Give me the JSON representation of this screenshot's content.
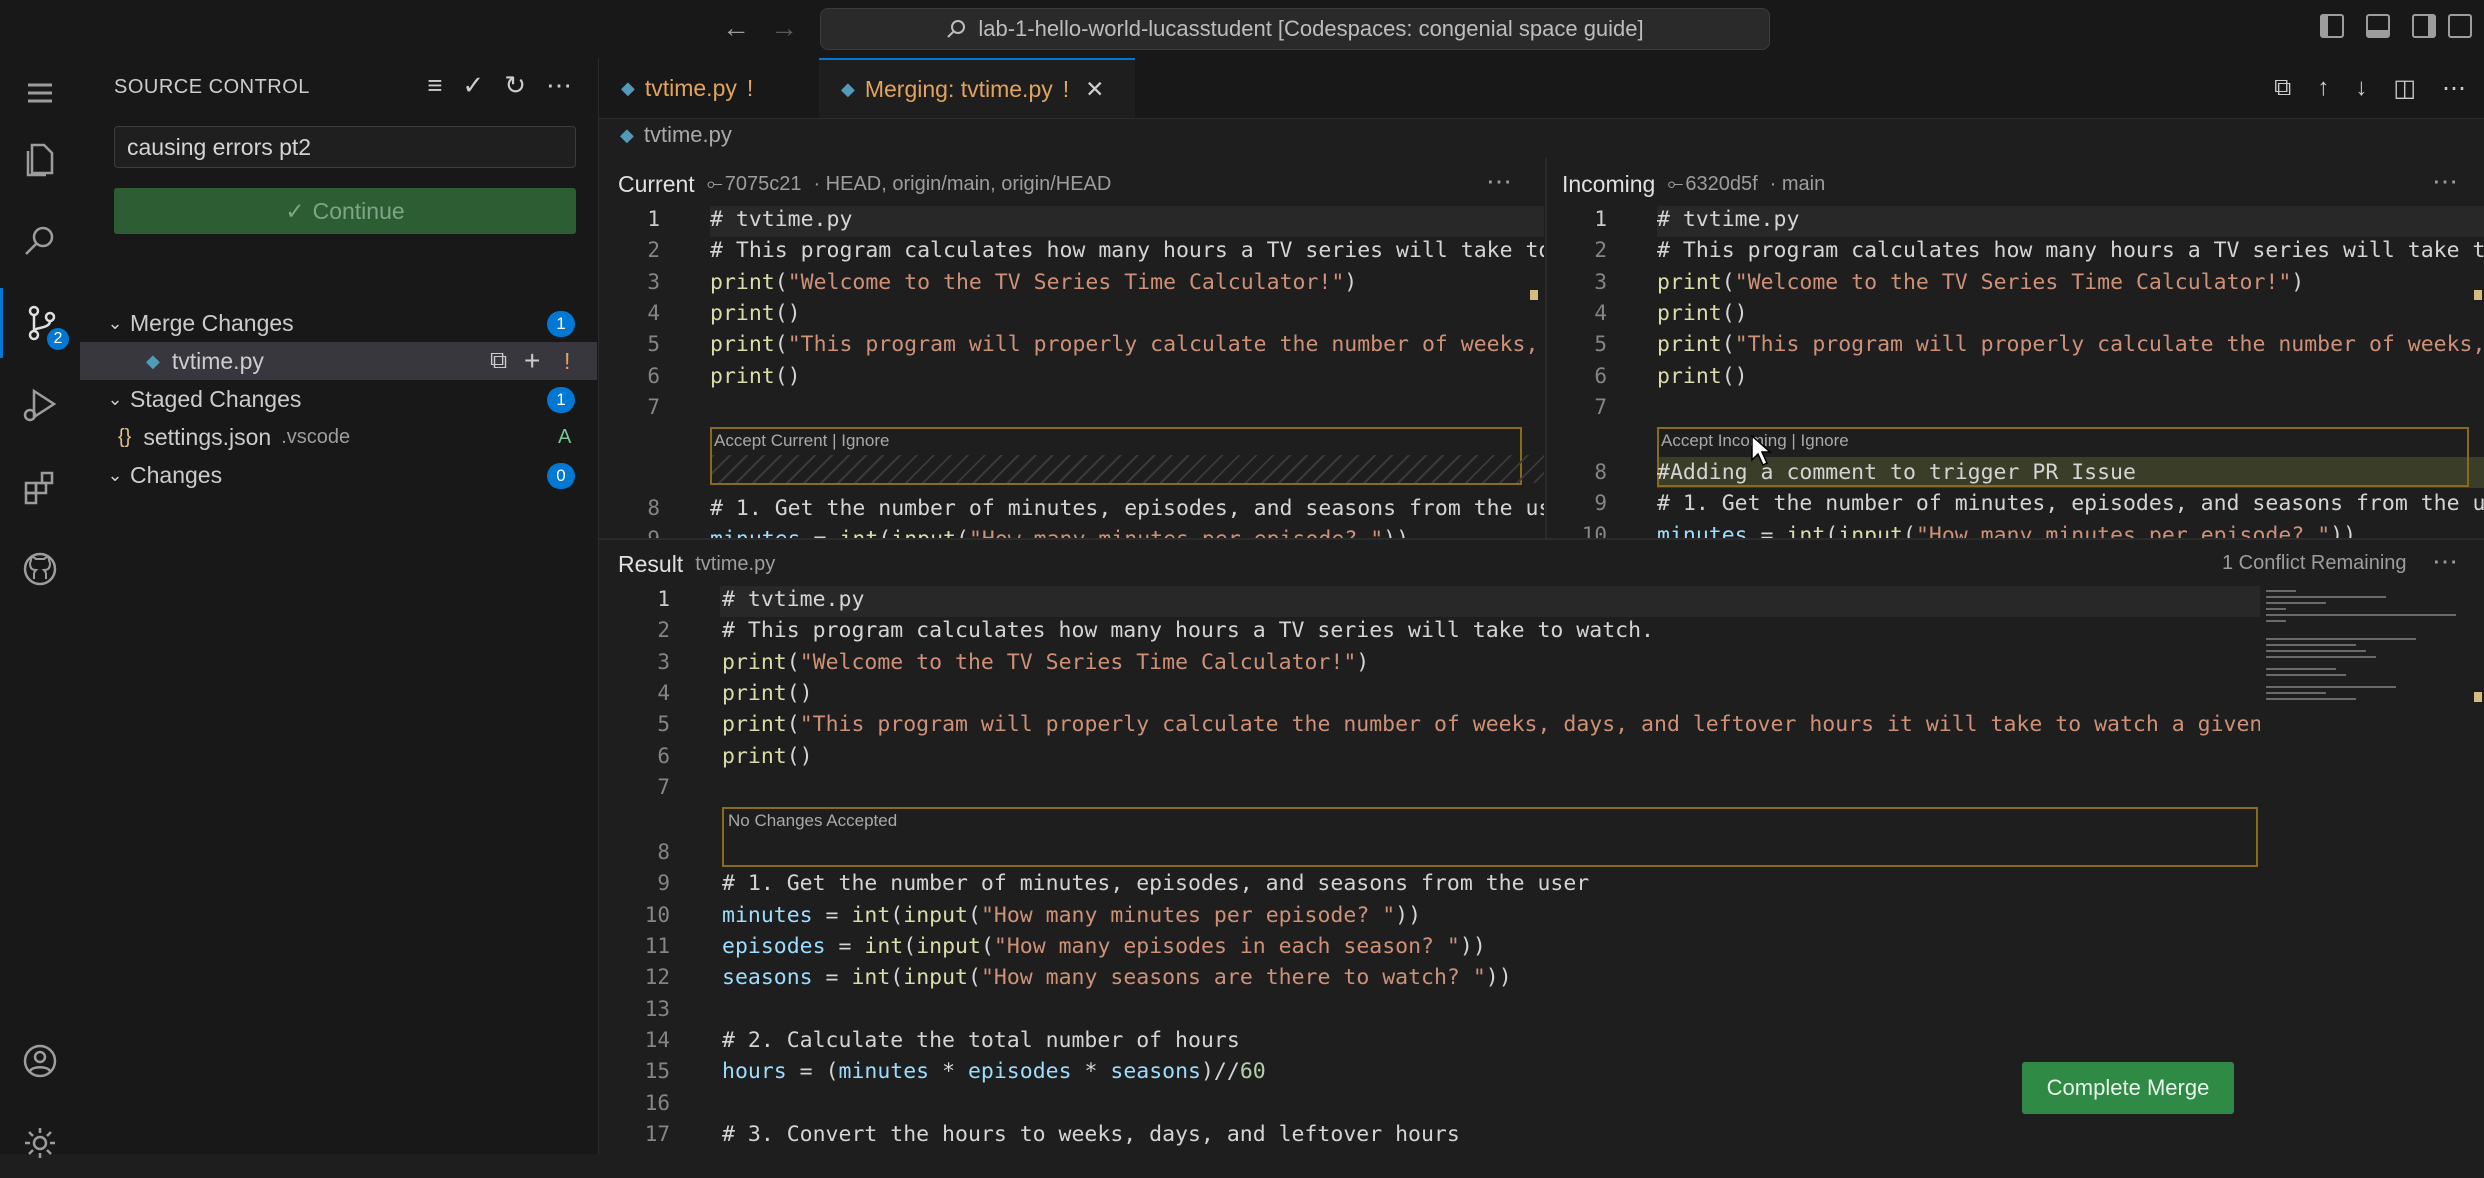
{
  "titlebar": {
    "back": "←",
    "forward": "→",
    "command_center": "lab-1-hello-world-lucasstudent [Codespaces: congenial space guide]"
  },
  "activity": {
    "scm_badge": "2"
  },
  "sidebar": {
    "title": "SOURCE CONTROL",
    "commit_message": "causing errors pt2",
    "continue_label": "Continue",
    "groups": [
      {
        "label": "Merge Changes",
        "count": "1"
      },
      {
        "label": "Staged Changes",
        "count": "1"
      },
      {
        "label": "Changes",
        "count": "0"
      }
    ],
    "merge_file": {
      "name": "tvtime.py",
      "status": "!"
    },
    "staged_file": {
      "name": "settings.json",
      "dir": ".vscode",
      "status": "A"
    }
  },
  "tabs": [
    {
      "label": "tvtime.py",
      "status": "!"
    },
    {
      "label": "Merging: tvtime.py",
      "status": "!"
    }
  ],
  "breadcrumb": "tvtime.py",
  "current": {
    "title": "Current",
    "commit": "7075c21",
    "refs": "· HEAD, origin/main, origin/HEAD",
    "codelens": "Accept Current | Ignore"
  },
  "incoming": {
    "title": "Incoming",
    "commit": "6320d5f",
    "refs": "· main",
    "codelens": "Accept Incoming | Ignore"
  },
  "result": {
    "title": "Result",
    "file": "tvtime.py",
    "conflicts": "1 Conflict Remaining",
    "codelens": "No Changes Accepted",
    "complete_label": "Complete Merge"
  },
  "code_top": [
    {
      "n": "1",
      "t": "# tvtime.py"
    },
    {
      "n": "2",
      "t": "# This program calculates how many hours a TV series will take to w"
    },
    {
      "n": "3",
      "t": "print(\"Welcome to the TV Series Time Calculator!\")"
    },
    {
      "n": "4",
      "t": "print()"
    },
    {
      "n": "5",
      "t": "print(\"This program will properly calculate the number of weeks, da"
    },
    {
      "n": "6",
      "t": "print()"
    },
    {
      "n": "7",
      "t": ""
    }
  ],
  "code_current_after": [
    {
      "n": "8",
      "t": "# 1. Get the number of minutes, episodes, and seasons from the user"
    },
    {
      "n": "9",
      "t": "minutes = int(input(\"How many minutes per episode? \"))"
    }
  ],
  "code_incoming_after": [
    {
      "n": "8",
      "t": "#Adding a comment to trigger PR Issue"
    },
    {
      "n": "9",
      "t": "# 1. Get the number of minutes, episodes, and seasons from the user"
    },
    {
      "n": "10",
      "t": "minutes = int(input(\"How many minutes per episode? \"))"
    }
  ],
  "code_result": [
    {
      "n": "1",
      "t": "# tvtime.py"
    },
    {
      "n": "2",
      "t": "# This program calculates how many hours a TV series will take to watch."
    },
    {
      "n": "3",
      "t": "print(\"Welcome to the TV Series Time Calculator!\")"
    },
    {
      "n": "4",
      "t": "print()"
    },
    {
      "n": "5",
      "t": "print(\"This program will properly calculate the number of weeks, days, and leftover hours it will take to watch a given TV"
    },
    {
      "n": "6",
      "t": "print()"
    },
    {
      "n": "7",
      "t": ""
    }
  ],
  "code_result_after": [
    {
      "n": "8",
      "t": ""
    },
    {
      "n": "9",
      "t": "# 1. Get the number of minutes, episodes, and seasons from the user"
    },
    {
      "n": "10",
      "t": "minutes = int(input(\"How many minutes per episode? \"))"
    },
    {
      "n": "11",
      "t": "episodes = int(input(\"How many episodes in each season? \"))"
    },
    {
      "n": "12",
      "t": "seasons = int(input(\"How many seasons are there to watch? \"))"
    },
    {
      "n": "13",
      "t": ""
    },
    {
      "n": "14",
      "t": "# 2. Calculate the total number of hours"
    },
    {
      "n": "15",
      "t": "hours = (minutes * episodes * seasons)//60"
    },
    {
      "n": "16",
      "t": ""
    },
    {
      "n": "17",
      "t": "# 3. Convert the hours to weeks, days, and leftover hours"
    }
  ]
}
